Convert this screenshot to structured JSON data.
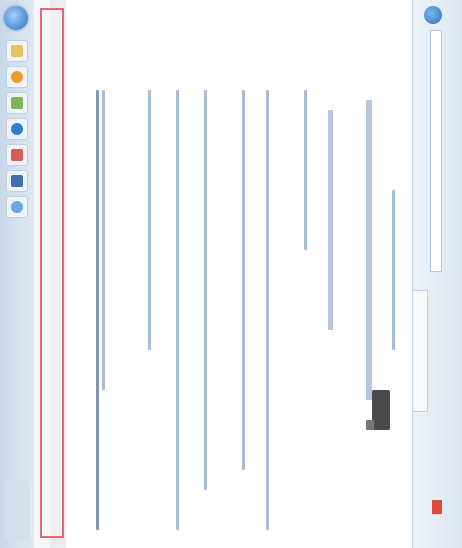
{
  "screen": {
    "orientation": "rotated-90",
    "legibility": "unreadable"
  },
  "browser": {
    "address_text": "",
    "tab_title": "",
    "page_heading": "",
    "page_lines": [
      "",
      "",
      "",
      "",
      "",
      "",
      "",
      "",
      ""
    ],
    "status_text": ""
  },
  "taskbar": {
    "apps": [
      "folder-icon",
      "media-icon",
      "image-icon",
      "browser-icon",
      "document-icon",
      "window-icon",
      "globe-icon"
    ],
    "clock": ""
  },
  "colors": {
    "highlight": "#e06a78",
    "accent": "#2f6fb8"
  }
}
